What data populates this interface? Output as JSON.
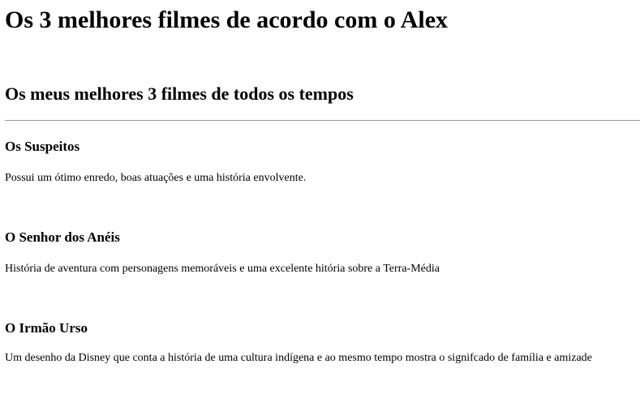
{
  "header": {
    "title": "Os 3 melhores filmes de acordo com o Alex"
  },
  "main": {
    "subtitle": "Os meus melhores 3 filmes de todos os tempos",
    "movies": [
      {
        "title": "Os Suspeitos",
        "description": "Possui um ótimo enredo, boas atuações e uma história envolvente."
      },
      {
        "title": "O Senhor dos Anéis",
        "description": "História de aventura com personagens memoráveis e uma excelente hitória sobre a Terra-Média"
      },
      {
        "title": "O Irmão Urso",
        "description": "Um desenho da Disney que conta a história de uma cultura indígena e ao mesmo tempo mostra o signifcado de família e amizade"
      }
    ]
  }
}
